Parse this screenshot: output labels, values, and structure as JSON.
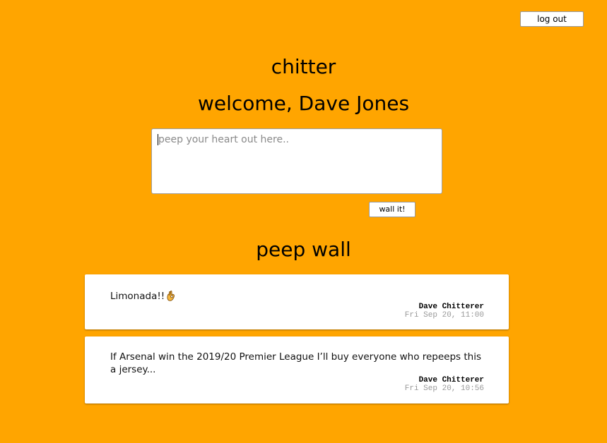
{
  "header": {
    "logout_label": "log out",
    "app_title": "chitter",
    "welcome": "welcome, Dave Jones"
  },
  "composer": {
    "placeholder": "peep your heart out here..",
    "value": "",
    "submit_label": "wall it!"
  },
  "wall": {
    "title": "peep wall",
    "peeps": [
      {
        "text": "Limonada!!",
        "emoji": "ok-hand-icon",
        "author": "Dave Chitterer",
        "time": "Fri Sep 20, 11:00"
      },
      {
        "text": "If Arsenal win the 2019/20 Premier League I’ll buy everyone who repeeps this a jersey...",
        "author": "Dave Chitterer",
        "time": "Fri Sep 20, 10:56"
      }
    ]
  },
  "colors": {
    "background": "#ffa500",
    "card": "#ffffff",
    "timestamp": "#9a9a9a"
  }
}
